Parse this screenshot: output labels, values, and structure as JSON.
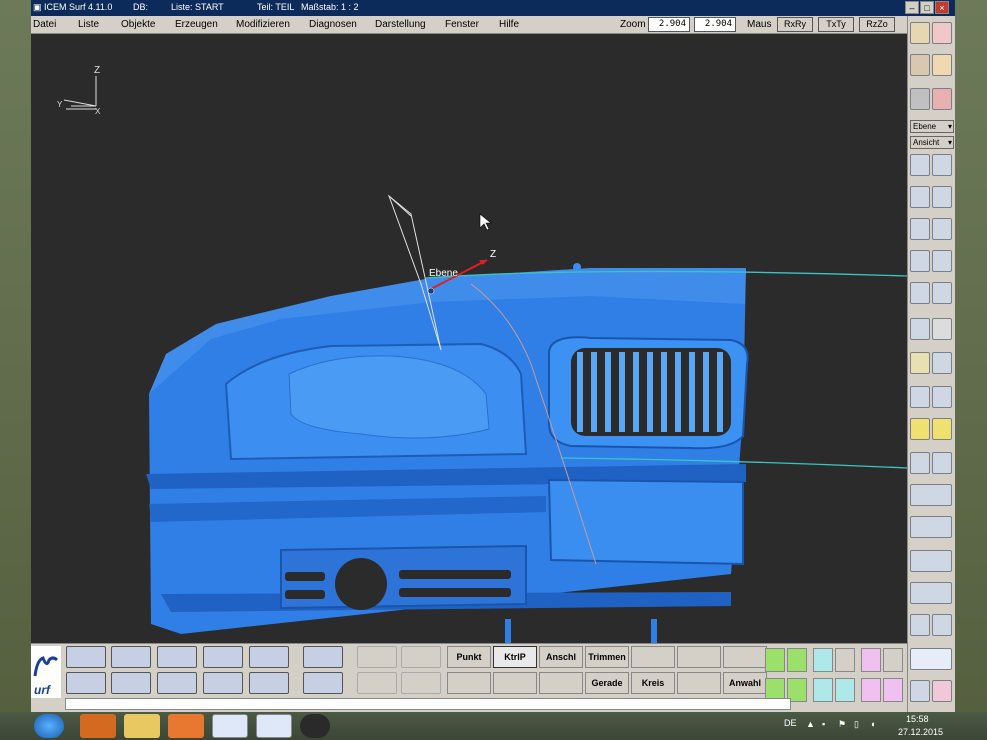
{
  "window": {
    "title": "ICEM Surf 4.11.0",
    "db": "DB:",
    "liste": "Liste: START",
    "teil": "Teil: TEIL",
    "massstab": "Maßstab: 1 : 2"
  },
  "menu": [
    "Datei",
    "Liste",
    "Objekte",
    "Erzeugen",
    "Modifizieren",
    "Diagnosen",
    "Darstellung",
    "Fenster",
    "Hilfe"
  ],
  "zoom": {
    "label": "Zoom",
    "value1": "2.904",
    "value2": "2.904",
    "maus_label": "Maus",
    "buttons": [
      "RxRy",
      "TxTy",
      "RzZo"
    ]
  },
  "viewport": {
    "axis_z_label": "Z",
    "axis_y_label": "Y",
    "axis_x_label": "X",
    "plane_label": "Ebene",
    "plane_axis_label": "Z"
  },
  "right_panel": {
    "combo1": "Ebene",
    "combo2": "Ansicht"
  },
  "bottom_toolbar": {
    "row1": [
      "Punkt",
      "KtrlP",
      "Anschl",
      "Trimmen"
    ],
    "row2": [
      "Gerade",
      "Kreis",
      "Anwahl"
    ],
    "active": "KtrlP",
    "logo_text": "urf"
  },
  "taskbar": {
    "language": "DE",
    "time": "15:58",
    "date": "27.12.2015"
  },
  "colors": {
    "model_blue": "#2f7fe6",
    "viewport_bg": "#2b2b2b",
    "title_blue": "#0c2b5a",
    "curve_cyan": "#3bc4c4"
  }
}
